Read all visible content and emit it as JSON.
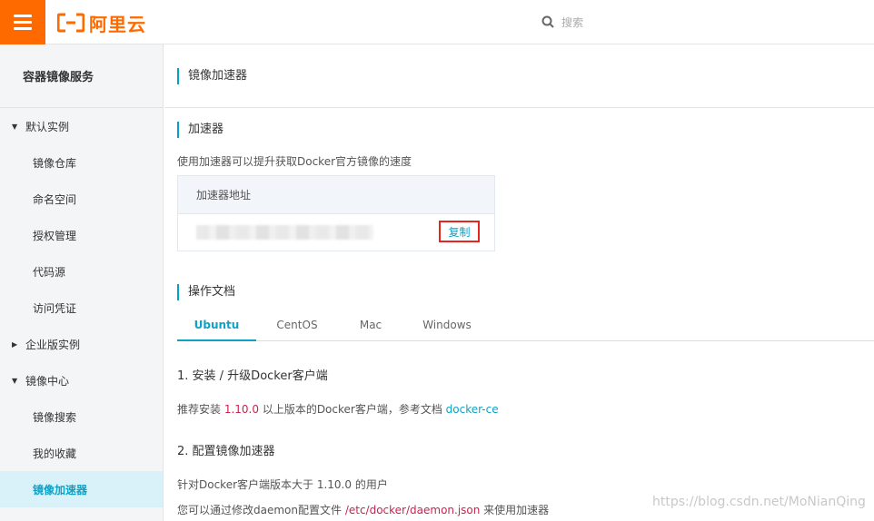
{
  "header": {
    "logo_text": "阿里云",
    "search_placeholder": "搜索",
    "brand_color": "#ff6a00"
  },
  "sidebar": {
    "title": "容器镜像服务",
    "groups": [
      {
        "label": "默认实例",
        "expanded": true,
        "items": [
          "镜像仓库",
          "命名空间",
          "授权管理",
          "代码源",
          "访问凭证"
        ]
      },
      {
        "label": "企业版实例",
        "expanded": false,
        "items": []
      },
      {
        "label": "镜像中心",
        "expanded": true,
        "items": [
          "镜像搜索",
          "我的收藏",
          "镜像加速器"
        ]
      }
    ],
    "active_item": "镜像加速器"
  },
  "main": {
    "page_title": "镜像加速器",
    "accelerator": {
      "section_title": "加速器",
      "description": "使用加速器可以提升获取Docker官方镜像的速度",
      "address_header": "加速器地址",
      "copy_label": "复制"
    },
    "docs": {
      "section_title": "操作文档",
      "tabs": [
        "Ubuntu",
        "CentOS",
        "Mac",
        "Windows"
      ],
      "active_tab": "Ubuntu",
      "step1_title": "1. 安装 / 升级Docker客户端",
      "step1_prefix": "推荐安装 ",
      "step1_version": "1.10.0",
      "step1_mid": " 以上版本的Docker客户端，参考文档 ",
      "step1_link": "docker-ce",
      "step2_title": "2. 配置镜像加速器",
      "step2_line1": "针对Docker客户端版本大于 1.10.0 的用户",
      "step2_line2_prefix": "您可以通过修改daemon配置文件 ",
      "step2_line2_path": "/etc/docker/daemon.json",
      "step2_line2_suffix": " 来使用加速器"
    }
  },
  "watermark": "https://blog.csdn.net/MoNianQing",
  "colors": {
    "accent": "#00a2ca",
    "active_bg": "#d9f1f8",
    "highlight_red": "#c7254e",
    "box_border_red": "#e5261f"
  }
}
